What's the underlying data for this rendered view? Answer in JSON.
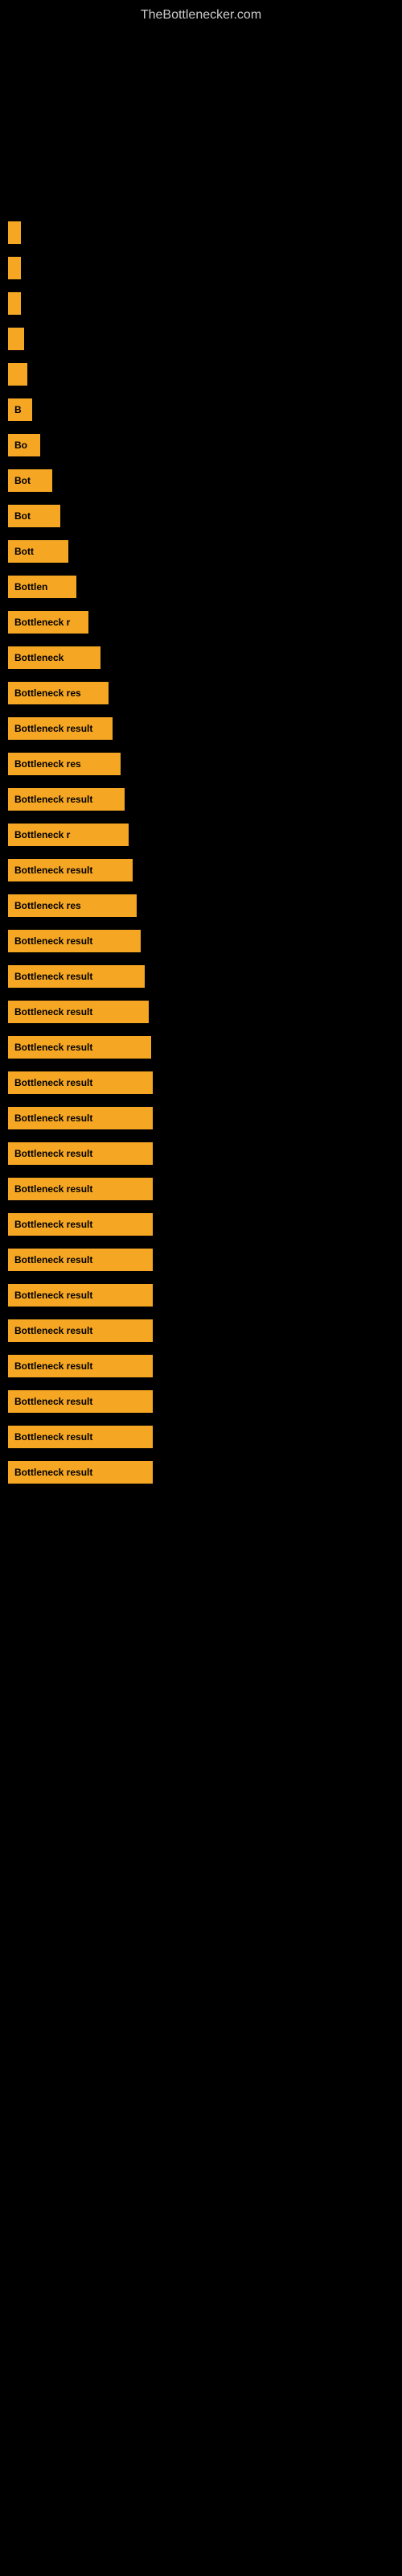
{
  "site": {
    "title": "TheBottlenecker.com"
  },
  "bars": [
    {
      "id": 1,
      "label": "",
      "width_class": "bar-w-1"
    },
    {
      "id": 2,
      "label": "",
      "width_class": "bar-w-2"
    },
    {
      "id": 3,
      "label": "",
      "width_class": "bar-w-3"
    },
    {
      "id": 4,
      "label": "",
      "width_class": "bar-w-4"
    },
    {
      "id": 5,
      "label": "",
      "width_class": "bar-w-5"
    },
    {
      "id": 6,
      "label": "B",
      "width_class": "bar-w-6"
    },
    {
      "id": 7,
      "label": "Bo",
      "width_class": "bar-w-7"
    },
    {
      "id": 8,
      "label": "Bot",
      "width_class": "bar-w-8"
    },
    {
      "id": 9,
      "label": "Bot",
      "width_class": "bar-w-9"
    },
    {
      "id": 10,
      "label": "Bott",
      "width_class": "bar-w-10"
    },
    {
      "id": 11,
      "label": "Bottlen",
      "width_class": "bar-w-11"
    },
    {
      "id": 12,
      "label": "Bottleneck r",
      "width_class": "bar-w-12"
    },
    {
      "id": 13,
      "label": "Bottleneck",
      "width_class": "bar-w-13"
    },
    {
      "id": 14,
      "label": "Bottleneck res",
      "width_class": "bar-w-14"
    },
    {
      "id": 15,
      "label": "Bottleneck result",
      "width_class": "bar-w-15"
    },
    {
      "id": 16,
      "label": "Bottleneck res",
      "width_class": "bar-w-16"
    },
    {
      "id": 17,
      "label": "Bottleneck result",
      "width_class": "bar-w-17"
    },
    {
      "id": 18,
      "label": "Bottleneck r",
      "width_class": "bar-w-18"
    },
    {
      "id": 19,
      "label": "Bottleneck result",
      "width_class": "bar-w-19"
    },
    {
      "id": 20,
      "label": "Bottleneck res",
      "width_class": "bar-w-20"
    },
    {
      "id": 21,
      "label": "Bottleneck result",
      "width_class": "bar-w-21"
    },
    {
      "id": 22,
      "label": "Bottleneck result",
      "width_class": "bar-w-22"
    },
    {
      "id": 23,
      "label": "Bottleneck result",
      "width_class": "bar-w-23"
    },
    {
      "id": 24,
      "label": "Bottleneck result",
      "width_class": "bar-w-24"
    },
    {
      "id": 25,
      "label": "Bottleneck result",
      "width_class": "bar-w-25"
    },
    {
      "id": 26,
      "label": "Bottleneck result",
      "width_class": "bar-w-25"
    },
    {
      "id": 27,
      "label": "Bottleneck result",
      "width_class": "bar-w-25"
    },
    {
      "id": 28,
      "label": "Bottleneck result",
      "width_class": "bar-w-25"
    },
    {
      "id": 29,
      "label": "Bottleneck result",
      "width_class": "bar-w-25"
    },
    {
      "id": 30,
      "label": "Bottleneck result",
      "width_class": "bar-w-25"
    },
    {
      "id": 31,
      "label": "Bottleneck result",
      "width_class": "bar-w-25"
    },
    {
      "id": 32,
      "label": "Bottleneck result",
      "width_class": "bar-w-25"
    },
    {
      "id": 33,
      "label": "Bottleneck result",
      "width_class": "bar-w-25"
    },
    {
      "id": 34,
      "label": "Bottleneck result",
      "width_class": "bar-w-25"
    },
    {
      "id": 35,
      "label": "Bottleneck result",
      "width_class": "bar-w-25"
    },
    {
      "id": 36,
      "label": "Bottleneck result",
      "width_class": "bar-w-25"
    }
  ],
  "colors": {
    "bar_fill": "#f5a623",
    "bar_text": "#000000",
    "background": "#000000",
    "title": "#cccccc"
  }
}
